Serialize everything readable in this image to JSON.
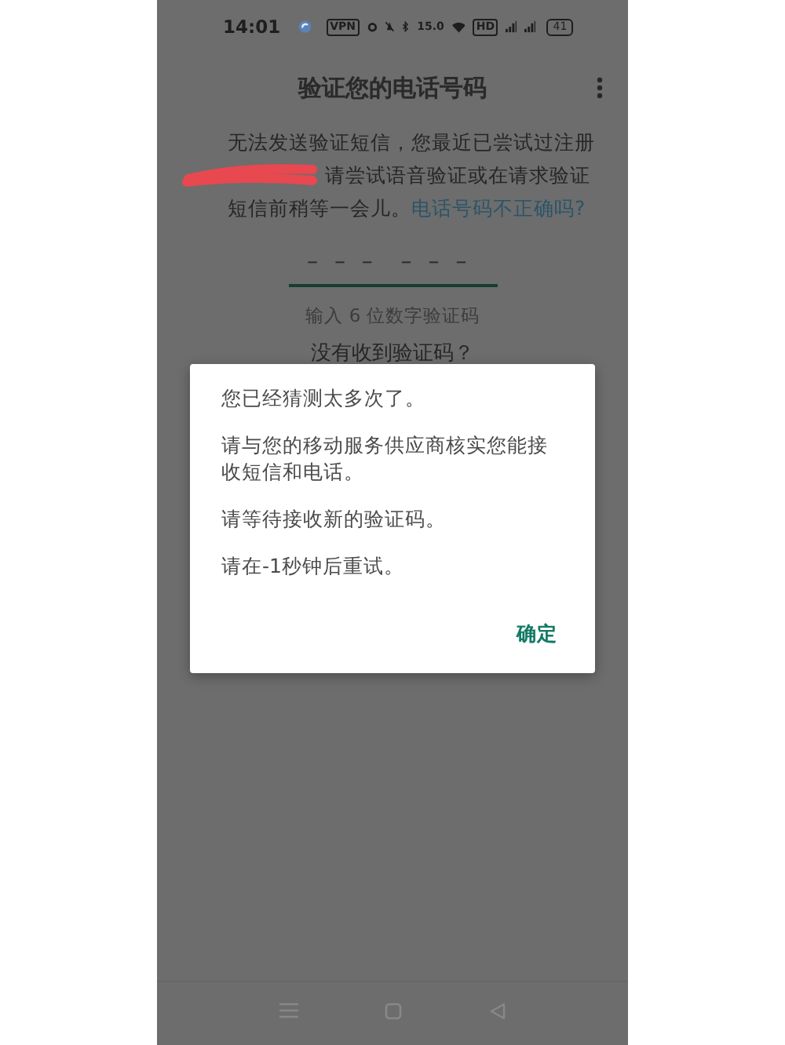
{
  "status_bar": {
    "time": "14:01",
    "vpn": "VPN",
    "speed": "15.0",
    "hd": "HD",
    "battery": "41"
  },
  "header": {
    "title": "验证您的电话号码"
  },
  "intro": {
    "line_1": "无法发送验证短信，您最近已尝试过注册",
    "line_2": "请尝试语音验证或在请求验证",
    "line_3": "短信前稍等一会儿。",
    "link": "电话号码不正确吗?"
  },
  "code_field": {
    "placeholder": "– – –  – – –"
  },
  "hint": "输入 6 位数字验证码",
  "resend_prompt": "没有收到验证码？",
  "dialog": {
    "paragraphs": [
      "您已经猜测太多次了。",
      "请与您的移动服务供应商核实您能接收短信和电话。",
      "请等待接收新的验证码。",
      "请在-1秒钟后重试。"
    ],
    "button": "确定"
  }
}
